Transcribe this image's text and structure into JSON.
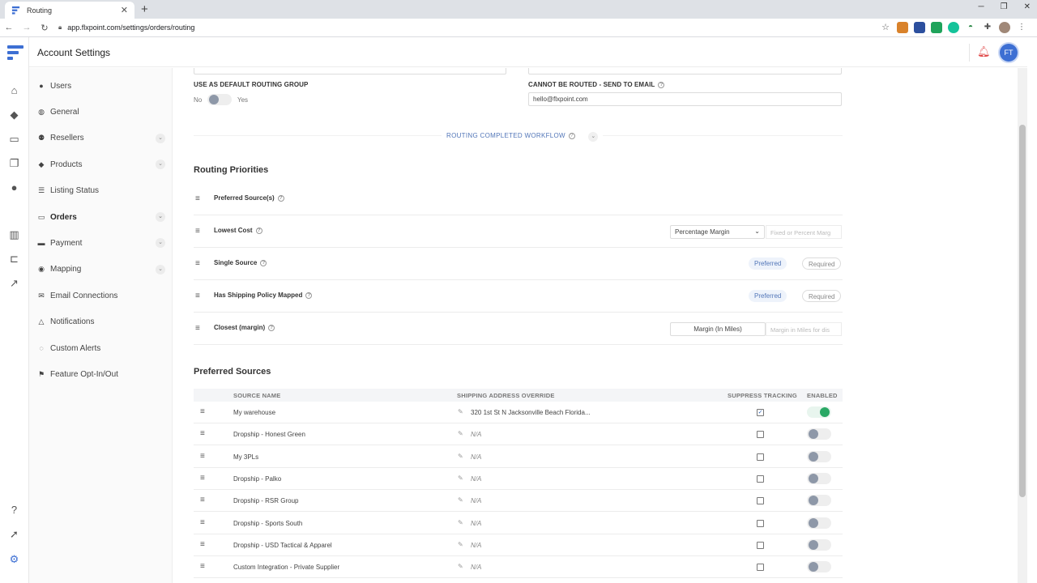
{
  "browser": {
    "tab_title": "Routing",
    "url": "app.flxpoint.com/settings/orders/routing"
  },
  "header": {
    "title": "Account Settings",
    "avatar_initials": "FT"
  },
  "sidebar": {
    "items": [
      {
        "label": "Users",
        "icon": "user-icon"
      },
      {
        "label": "General",
        "icon": "globe-icon"
      },
      {
        "label": "Resellers",
        "icon": "users-icon",
        "expandable": true
      },
      {
        "label": "Products",
        "icon": "tag-icon",
        "expandable": true
      },
      {
        "label": "Listing Status",
        "icon": "list-icon"
      },
      {
        "label": "Orders",
        "icon": "inbox-icon",
        "expandable": true,
        "active": true
      },
      {
        "label": "Payment",
        "icon": "credit-card-icon",
        "expandable": true
      },
      {
        "label": "Mapping",
        "icon": "map-icon",
        "expandable": true
      },
      {
        "label": "Email Connections",
        "icon": "envelope-icon"
      },
      {
        "label": "Notifications",
        "icon": "bell-icon"
      },
      {
        "label": "Custom Alerts",
        "icon": "chat-icon"
      },
      {
        "label": "Feature Opt-In/Out",
        "icon": "flag-icon"
      }
    ]
  },
  "routing": {
    "default_group_label": "USE AS DEFAULT ROUTING GROUP",
    "toggle_no": "No",
    "toggle_yes": "Yes",
    "send_email_label": "CANNOT BE ROUTED - SEND TO EMAIL",
    "send_email_value": "hello@flxpoint.com",
    "completed_workflow": "ROUTING COMPLETED WORKFLOW"
  },
  "priorities": {
    "title": "Routing Priorities",
    "rows": [
      {
        "name": "Preferred Source(s)"
      },
      {
        "name": "Lowest Cost",
        "select": "Percentage Margin",
        "placeholder": "Fixed or Percent Marg"
      },
      {
        "name": "Single Source",
        "pill1": "Preferred",
        "pill2": "Required"
      },
      {
        "name": "Has Shipping Policy Mapped",
        "pill1": "Preferred",
        "pill2": "Required"
      },
      {
        "name": "Closest (margin)",
        "select": "Margin (In Miles)",
        "placeholder": "Margin in Miles for dis"
      }
    ]
  },
  "sources": {
    "title": "Preferred Sources",
    "columns": {
      "name": "SOURCE NAME",
      "address": "SHIPPING ADDRESS OVERRIDE",
      "suppress": "SUPPRESS TRACKING",
      "enabled": "ENABLED"
    },
    "rows": [
      {
        "name": "My warehouse",
        "address": "320 1st St N Jacksonville Beach Florida...",
        "suppress": true,
        "enabled": true
      },
      {
        "name": "Dropship - Honest Green",
        "address": "N/A",
        "suppress": false,
        "enabled": false
      },
      {
        "name": "My 3PLs",
        "address": "N/A",
        "suppress": false,
        "enabled": false
      },
      {
        "name": "Dropship - Palko",
        "address": "N/A",
        "suppress": false,
        "enabled": false
      },
      {
        "name": "Dropship - RSR Group",
        "address": "N/A",
        "suppress": false,
        "enabled": false
      },
      {
        "name": "Dropship - Sports South",
        "address": "N/A",
        "suppress": false,
        "enabled": false
      },
      {
        "name": "Dropship - USD Tactical & Apparel",
        "address": "N/A",
        "suppress": false,
        "enabled": false
      },
      {
        "name": "Custom Integration - Private Supplier",
        "address": "N/A",
        "suppress": false,
        "enabled": false
      }
    ]
  }
}
